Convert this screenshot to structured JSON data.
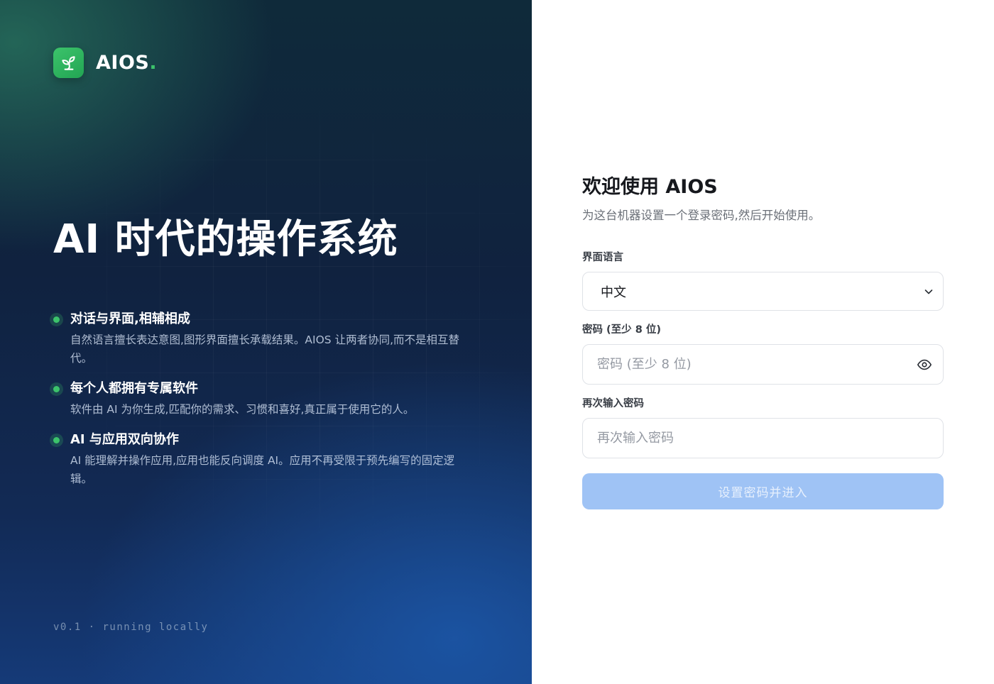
{
  "brand": {
    "logo_icon": "sprout-icon",
    "name": "AIOS",
    "dot": ".",
    "accent_color": "#3cc36b"
  },
  "hero": {
    "title": "AI 时代的操作系统",
    "features": [
      {
        "title": "对话与界面,相辅相成",
        "description": "自然语言擅长表达意图,图形界面擅长承载结果。AIOS 让两者协同,而不是相互替代。"
      },
      {
        "title": "每个人都拥有专属软件",
        "description": "软件由 AI 为你生成,匹配你的需求、习惯和喜好,真正属于使用它的人。"
      },
      {
        "title": "AI 与应用双向协作",
        "description": "AI 能理解并操作应用,应用也能反向调度 AI。应用不再受限于预先编写的固定逻辑。"
      }
    ],
    "version": "v0.1 · running locally"
  },
  "form": {
    "title": "欢迎使用 AIOS",
    "subtitle": "为这台机器设置一个登录密码,然后开始使用。",
    "language_label": "界面语言",
    "language_value": "中文",
    "language_icon": "chevron-down-icon",
    "password_label": "密码 (至少 8 位)",
    "password_placeholder": "密码 (至少 8 位)",
    "password_value": "",
    "password_icon": "eye-icon",
    "confirm_label": "再次输入密码",
    "confirm_placeholder": "再次输入密码",
    "confirm_value": "",
    "submit_label": "设置密码并进入",
    "submit_color": "#9fc3f5"
  }
}
